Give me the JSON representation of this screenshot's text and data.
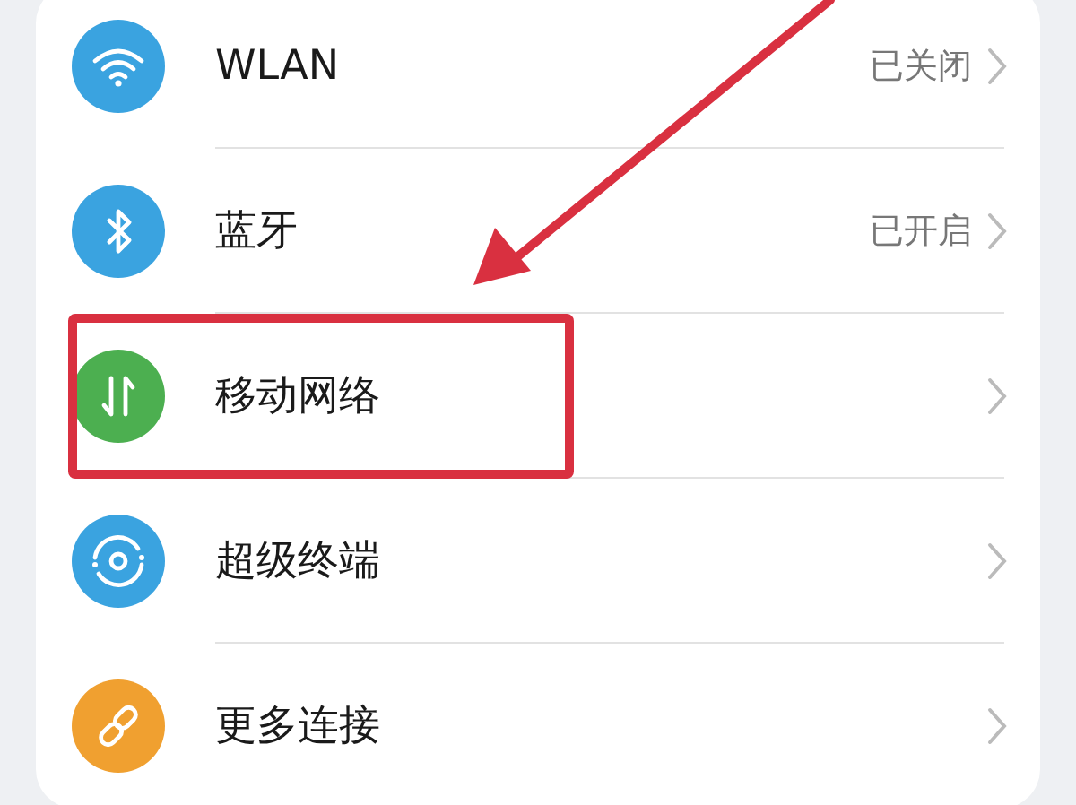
{
  "settings_items": [
    {
      "kind": "wifi",
      "label": "WLAN",
      "value": "已关闭",
      "color": "#3aa3e0",
      "highlighted": false
    },
    {
      "kind": "bluetooth",
      "label": "蓝牙",
      "value": "已开启",
      "color": "#3aa3e0",
      "highlighted": false
    },
    {
      "kind": "mobile",
      "label": "移动网络",
      "color": "#4caf50",
      "highlighted": true
    },
    {
      "kind": "super",
      "label": "超级终端",
      "color": "#3aa3e0",
      "highlighted": false
    },
    {
      "kind": "link",
      "label": "更多连接",
      "color": "#f0a030",
      "highlighted": false
    }
  ]
}
